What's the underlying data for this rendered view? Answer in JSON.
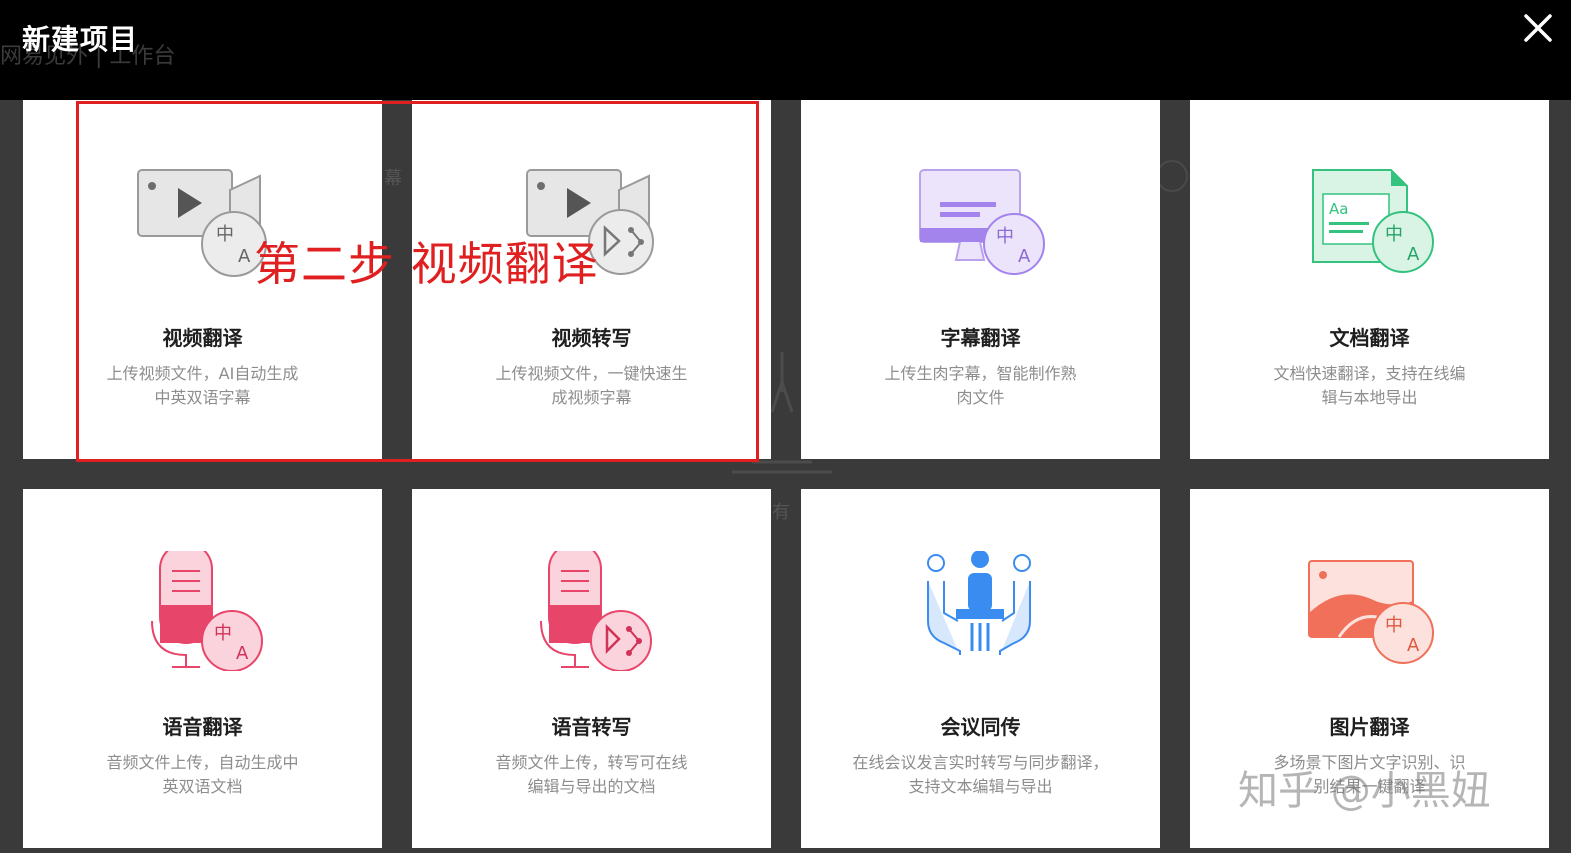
{
  "background_page": {
    "title": "网易见外 | 工作台",
    "fragments": [
      "幕",
      "有"
    ]
  },
  "modal": {
    "title": "新建项目",
    "close_icon": "close-icon"
  },
  "cards": [
    {
      "title": "视频翻译",
      "desc": "上传视频文件，AI自动生成中英双语字幕",
      "icon": "video-translate-icon"
    },
    {
      "title": "视频转写",
      "desc": "上传视频文件，一键快速生成视频字幕",
      "icon": "video-transcribe-icon"
    },
    {
      "title": "字幕翻译",
      "desc": "上传生肉字幕，智能制作熟肉文件",
      "icon": "subtitle-translate-icon"
    },
    {
      "title": "文档翻译",
      "desc": "文档快速翻译，支持在线编辑与本地导出",
      "icon": "document-translate-icon"
    },
    {
      "title": "语音翻译",
      "desc": "音频文件上传，自动生成中英双语文档",
      "icon": "audio-translate-icon"
    },
    {
      "title": "语音转写",
      "desc": "音频文件上传，转写可在线编辑与导出的文档",
      "icon": "audio-transcribe-icon"
    },
    {
      "title": "会议同传",
      "desc": "在线会议发言实时转写与同步翻译，支持文本编辑与导出",
      "icon": "meeting-interpret-icon"
    },
    {
      "title": "图片翻译",
      "desc": "多场景下图片文字识别、识别结果一键翻译",
      "icon": "image-translate-icon"
    }
  ],
  "annotation": "第二步 视频翻译",
  "watermark": "知乎 @小黑妞",
  "colors": {
    "header_bg": "#000000",
    "overlay": "#3a3a3a",
    "highlight_border": "#e02020",
    "purple": "#a383ec",
    "green": "#34c27f",
    "pink": "#e8456a",
    "blue": "#3b8cf0",
    "coral": "#f0705a"
  }
}
